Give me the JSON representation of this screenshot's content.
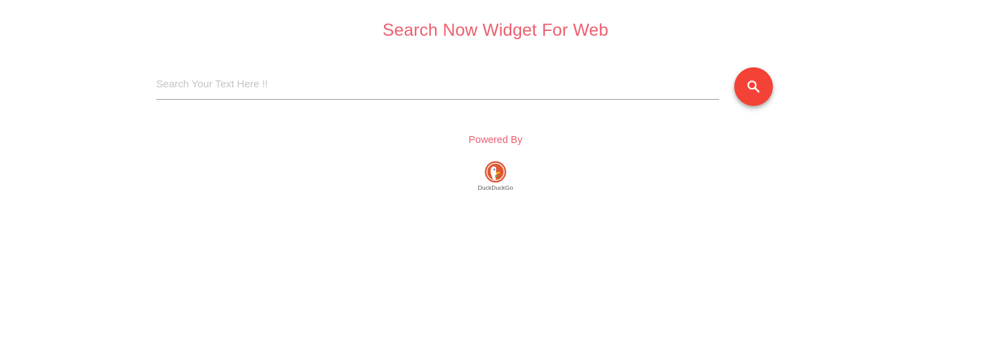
{
  "header": {
    "title": "Search Now Widget For Web"
  },
  "search": {
    "placeholder": "Search Your Text Here !!",
    "value": "",
    "button_icon": "search-icon",
    "button_color": "#f44336"
  },
  "footer": {
    "powered_by": "Powered By",
    "provider_name": "DuckDuckGo",
    "provider_icon": "duckduckgo-logo-icon"
  },
  "colors": {
    "accent_text": "#ec5f6e",
    "button": "#f44336"
  }
}
